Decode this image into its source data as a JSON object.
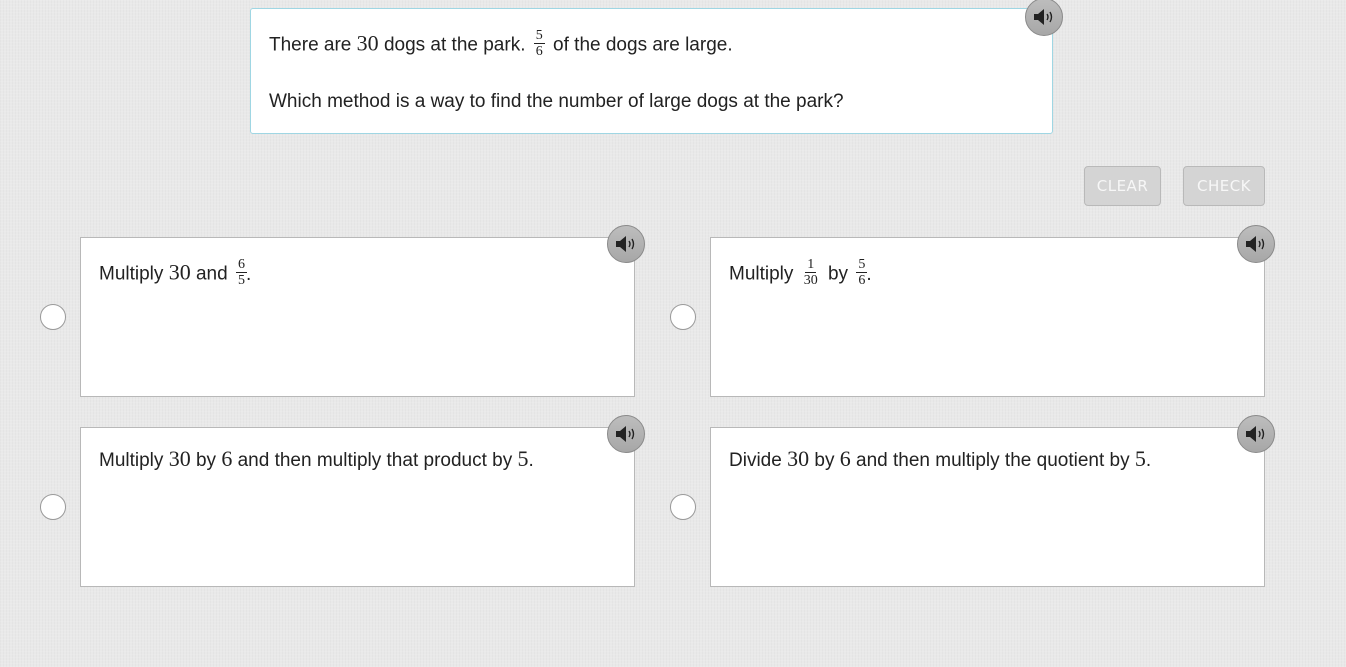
{
  "question": {
    "line1": {
      "pre": "There are",
      "number": "30",
      "mid": "dogs at the park.",
      "fraction": {
        "num": "5",
        "den": "6"
      },
      "post": "of the dogs are large."
    },
    "line2": "Which method is a way to find the number of large dogs at the park?",
    "audio_icon": "speaker-icon"
  },
  "buttons": {
    "clear": "CLEAR",
    "check": "CHECK"
  },
  "options": [
    {
      "t1": "Multiply",
      "n1": "30",
      "t2": "and",
      "frac": {
        "num": "6",
        "den": "5"
      },
      "end": "."
    },
    {
      "t1": "Multiply",
      "frac1": {
        "num": "1",
        "den": "30"
      },
      "t2": "by",
      "frac2": {
        "num": "5",
        "den": "6"
      },
      "end": "."
    },
    {
      "t1": "Multiply",
      "n1": "30",
      "t2": "by",
      "n2": "6",
      "t3": "and then multiply that product by",
      "n3": "5",
      "end": "."
    },
    {
      "t1": "Divide",
      "n1": "30",
      "t2": "by",
      "n2": "6",
      "t3": "and then multiply the quotient by",
      "n3": "5",
      "end": "."
    }
  ],
  "colors": {
    "question_border": "#9fd6e3",
    "audio_button": "#b2b2b2",
    "disabled_button": "#d4d4d4"
  }
}
